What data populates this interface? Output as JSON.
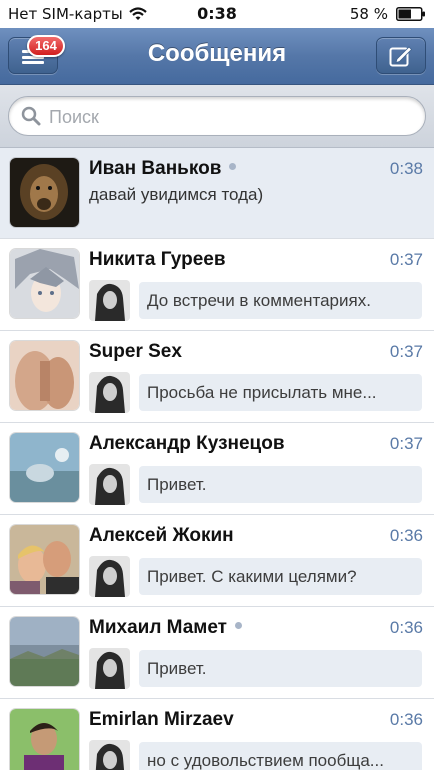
{
  "status_bar": {
    "carrier": "Нет SIM-карты",
    "time": "0:38",
    "battery": "58 %",
    "battery_level": 0.58
  },
  "nav": {
    "title": "Сообщения",
    "badge_count": "164",
    "menu_icon": "menu-icon",
    "compose_icon": "compose-icon"
  },
  "search": {
    "placeholder": "Поиск",
    "value": ""
  },
  "dialogs": [
    {
      "name": "Иван Ваньков",
      "time": "0:38",
      "online": true,
      "unread": true,
      "message": "давай увидимся тода)"
    },
    {
      "name": "Никита Гуреев",
      "time": "0:37",
      "online": false,
      "unread": false,
      "message": "До встречи в комментариях."
    },
    {
      "name": "Super Sex",
      "time": "0:37",
      "online": false,
      "unread": false,
      "message": "Просьба не присылать мне..."
    },
    {
      "name": "Александр Кузнецов",
      "time": "0:37",
      "online": false,
      "unread": false,
      "message": "Привет."
    },
    {
      "name": "Алексей Жокин",
      "time": "0:36",
      "online": false,
      "unread": false,
      "message": "Привет. С какими целями?"
    },
    {
      "name": "Михаил Мамет",
      "time": "0:36",
      "online": true,
      "unread": false,
      "message": "Привет."
    },
    {
      "name": "Emirlan Mirzaev",
      "time": "0:36",
      "online": false,
      "unread": false,
      "message": "но с удовольствием пообща..."
    }
  ],
  "colors": {
    "nav_bar": "#5577a8",
    "badge": "#d11f1f",
    "time_text": "#5a7aa7",
    "unread_row": "#e7ecf3",
    "bubble": "#e8edf3"
  }
}
